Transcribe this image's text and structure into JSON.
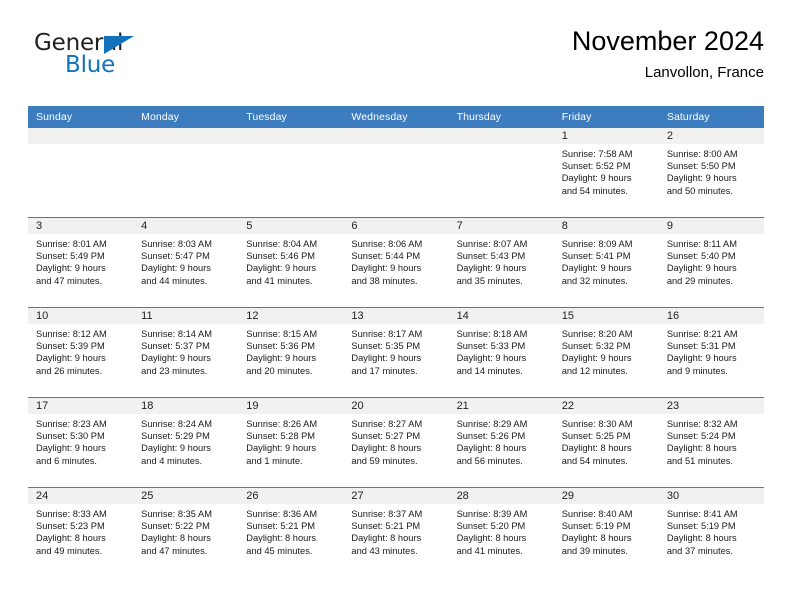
{
  "brand": {
    "name_part1": "General",
    "name_part2": "Blue",
    "triangle_icon": "triangle-icon",
    "accent_color": "#1273bd"
  },
  "header": {
    "title": "November 2024",
    "subtitle": "Lanvollon, France"
  },
  "theme": {
    "header_blue": "#3c7cbf",
    "daynum_gray": "#f1f1f1",
    "text_black": "#000000"
  },
  "calendar": {
    "weekday_headers": [
      "Sunday",
      "Monday",
      "Tuesday",
      "Wednesday",
      "Thursday",
      "Friday",
      "Saturday"
    ],
    "weeks": [
      [
        {
          "day": "",
          "sunrise": "",
          "sunset": "",
          "daylight_line1": "",
          "daylight_line2": ""
        },
        {
          "day": "",
          "sunrise": "",
          "sunset": "",
          "daylight_line1": "",
          "daylight_line2": ""
        },
        {
          "day": "",
          "sunrise": "",
          "sunset": "",
          "daylight_line1": "",
          "daylight_line2": ""
        },
        {
          "day": "",
          "sunrise": "",
          "sunset": "",
          "daylight_line1": "",
          "daylight_line2": ""
        },
        {
          "day": "",
          "sunrise": "",
          "sunset": "",
          "daylight_line1": "",
          "daylight_line2": ""
        },
        {
          "day": "1",
          "sunrise": "Sunrise: 7:58 AM",
          "sunset": "Sunset: 5:52 PM",
          "daylight_line1": "Daylight: 9 hours",
          "daylight_line2": "and 54 minutes."
        },
        {
          "day": "2",
          "sunrise": "Sunrise: 8:00 AM",
          "sunset": "Sunset: 5:50 PM",
          "daylight_line1": "Daylight: 9 hours",
          "daylight_line2": "and 50 minutes."
        }
      ],
      [
        {
          "day": "3",
          "sunrise": "Sunrise: 8:01 AM",
          "sunset": "Sunset: 5:49 PM",
          "daylight_line1": "Daylight: 9 hours",
          "daylight_line2": "and 47 minutes."
        },
        {
          "day": "4",
          "sunrise": "Sunrise: 8:03 AM",
          "sunset": "Sunset: 5:47 PM",
          "daylight_line1": "Daylight: 9 hours",
          "daylight_line2": "and 44 minutes."
        },
        {
          "day": "5",
          "sunrise": "Sunrise: 8:04 AM",
          "sunset": "Sunset: 5:46 PM",
          "daylight_line1": "Daylight: 9 hours",
          "daylight_line2": "and 41 minutes."
        },
        {
          "day": "6",
          "sunrise": "Sunrise: 8:06 AM",
          "sunset": "Sunset: 5:44 PM",
          "daylight_line1": "Daylight: 9 hours",
          "daylight_line2": "and 38 minutes."
        },
        {
          "day": "7",
          "sunrise": "Sunrise: 8:07 AM",
          "sunset": "Sunset: 5:43 PM",
          "daylight_line1": "Daylight: 9 hours",
          "daylight_line2": "and 35 minutes."
        },
        {
          "day": "8",
          "sunrise": "Sunrise: 8:09 AM",
          "sunset": "Sunset: 5:41 PM",
          "daylight_line1": "Daylight: 9 hours",
          "daylight_line2": "and 32 minutes."
        },
        {
          "day": "9",
          "sunrise": "Sunrise: 8:11 AM",
          "sunset": "Sunset: 5:40 PM",
          "daylight_line1": "Daylight: 9 hours",
          "daylight_line2": "and 29 minutes."
        }
      ],
      [
        {
          "day": "10",
          "sunrise": "Sunrise: 8:12 AM",
          "sunset": "Sunset: 5:39 PM",
          "daylight_line1": "Daylight: 9 hours",
          "daylight_line2": "and 26 minutes."
        },
        {
          "day": "11",
          "sunrise": "Sunrise: 8:14 AM",
          "sunset": "Sunset: 5:37 PM",
          "daylight_line1": "Daylight: 9 hours",
          "daylight_line2": "and 23 minutes."
        },
        {
          "day": "12",
          "sunrise": "Sunrise: 8:15 AM",
          "sunset": "Sunset: 5:36 PM",
          "daylight_line1": "Daylight: 9 hours",
          "daylight_line2": "and 20 minutes."
        },
        {
          "day": "13",
          "sunrise": "Sunrise: 8:17 AM",
          "sunset": "Sunset: 5:35 PM",
          "daylight_line1": "Daylight: 9 hours",
          "daylight_line2": "and 17 minutes."
        },
        {
          "day": "14",
          "sunrise": "Sunrise: 8:18 AM",
          "sunset": "Sunset: 5:33 PM",
          "daylight_line1": "Daylight: 9 hours",
          "daylight_line2": "and 14 minutes."
        },
        {
          "day": "15",
          "sunrise": "Sunrise: 8:20 AM",
          "sunset": "Sunset: 5:32 PM",
          "daylight_line1": "Daylight: 9 hours",
          "daylight_line2": "and 12 minutes."
        },
        {
          "day": "16",
          "sunrise": "Sunrise: 8:21 AM",
          "sunset": "Sunset: 5:31 PM",
          "daylight_line1": "Daylight: 9 hours",
          "daylight_line2": "and 9 minutes."
        }
      ],
      [
        {
          "day": "17",
          "sunrise": "Sunrise: 8:23 AM",
          "sunset": "Sunset: 5:30 PM",
          "daylight_line1": "Daylight: 9 hours",
          "daylight_line2": "and 6 minutes."
        },
        {
          "day": "18",
          "sunrise": "Sunrise: 8:24 AM",
          "sunset": "Sunset: 5:29 PM",
          "daylight_line1": "Daylight: 9 hours",
          "daylight_line2": "and 4 minutes."
        },
        {
          "day": "19",
          "sunrise": "Sunrise: 8:26 AM",
          "sunset": "Sunset: 5:28 PM",
          "daylight_line1": "Daylight: 9 hours",
          "daylight_line2": "and 1 minute."
        },
        {
          "day": "20",
          "sunrise": "Sunrise: 8:27 AM",
          "sunset": "Sunset: 5:27 PM",
          "daylight_line1": "Daylight: 8 hours",
          "daylight_line2": "and 59 minutes."
        },
        {
          "day": "21",
          "sunrise": "Sunrise: 8:29 AM",
          "sunset": "Sunset: 5:26 PM",
          "daylight_line1": "Daylight: 8 hours",
          "daylight_line2": "and 56 minutes."
        },
        {
          "day": "22",
          "sunrise": "Sunrise: 8:30 AM",
          "sunset": "Sunset: 5:25 PM",
          "daylight_line1": "Daylight: 8 hours",
          "daylight_line2": "and 54 minutes."
        },
        {
          "day": "23",
          "sunrise": "Sunrise: 8:32 AM",
          "sunset": "Sunset: 5:24 PM",
          "daylight_line1": "Daylight: 8 hours",
          "daylight_line2": "and 51 minutes."
        }
      ],
      [
        {
          "day": "24",
          "sunrise": "Sunrise: 8:33 AM",
          "sunset": "Sunset: 5:23 PM",
          "daylight_line1": "Daylight: 8 hours",
          "daylight_line2": "and 49 minutes."
        },
        {
          "day": "25",
          "sunrise": "Sunrise: 8:35 AM",
          "sunset": "Sunset: 5:22 PM",
          "daylight_line1": "Daylight: 8 hours",
          "daylight_line2": "and 47 minutes."
        },
        {
          "day": "26",
          "sunrise": "Sunrise: 8:36 AM",
          "sunset": "Sunset: 5:21 PM",
          "daylight_line1": "Daylight: 8 hours",
          "daylight_line2": "and 45 minutes."
        },
        {
          "day": "27",
          "sunrise": "Sunrise: 8:37 AM",
          "sunset": "Sunset: 5:21 PM",
          "daylight_line1": "Daylight: 8 hours",
          "daylight_line2": "and 43 minutes."
        },
        {
          "day": "28",
          "sunrise": "Sunrise: 8:39 AM",
          "sunset": "Sunset: 5:20 PM",
          "daylight_line1": "Daylight: 8 hours",
          "daylight_line2": "and 41 minutes."
        },
        {
          "day": "29",
          "sunrise": "Sunrise: 8:40 AM",
          "sunset": "Sunset: 5:19 PM",
          "daylight_line1": "Daylight: 8 hours",
          "daylight_line2": "and 39 minutes."
        },
        {
          "day": "30",
          "sunrise": "Sunrise: 8:41 AM",
          "sunset": "Sunset: 5:19 PM",
          "daylight_line1": "Daylight: 8 hours",
          "daylight_line2": "and 37 minutes."
        }
      ]
    ]
  }
}
